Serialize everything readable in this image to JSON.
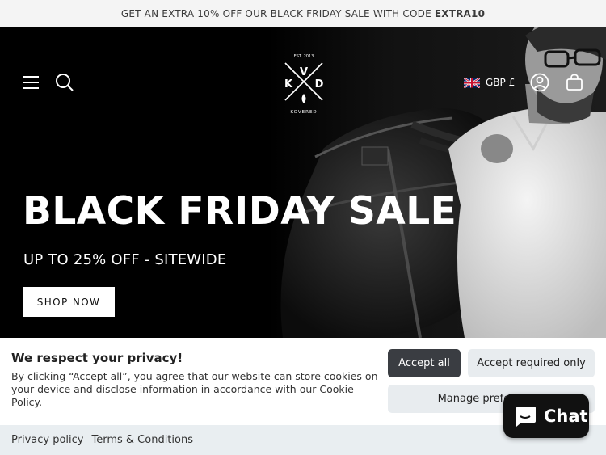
{
  "announcement": {
    "text": "GET AN EXTRA 10% OFF OUR BLACK FRIDAY SALE WITH CODE",
    "code": "EXTRA10"
  },
  "header": {
    "currency": "GBP £",
    "logo": {
      "est": "EST. 2013",
      "letters": [
        "K",
        "V",
        "D"
      ],
      "brand": "KOVERED"
    },
    "icons": [
      "menu-icon",
      "search-icon",
      "flag-uk-icon",
      "account-icon",
      "cart-icon"
    ]
  },
  "hero": {
    "title": "BLACK FRIDAY SALE",
    "subtitle": "UP TO 25% OFF - SITEWIDE",
    "cta": "SHOP NOW"
  },
  "cookie_banner": {
    "title": "We respect your privacy!",
    "text": "By clicking “Accept all”, you agree that our website can store cookies on your device and disclose information in accordance with our Cookie Policy.",
    "accept_all": "Accept all",
    "accept_required": "Accept required only",
    "manage": "Manage preferences"
  },
  "policy_links": {
    "privacy": "Privacy policy",
    "terms": "Terms & Conditions"
  },
  "chat": {
    "label": "Chat"
  },
  "colors": {
    "hero_bg": "#000000",
    "accept_bg": "#3a3d42",
    "secondary_btn_bg": "#e8ecef",
    "policy_bar_bg": "#e9eef1"
  }
}
